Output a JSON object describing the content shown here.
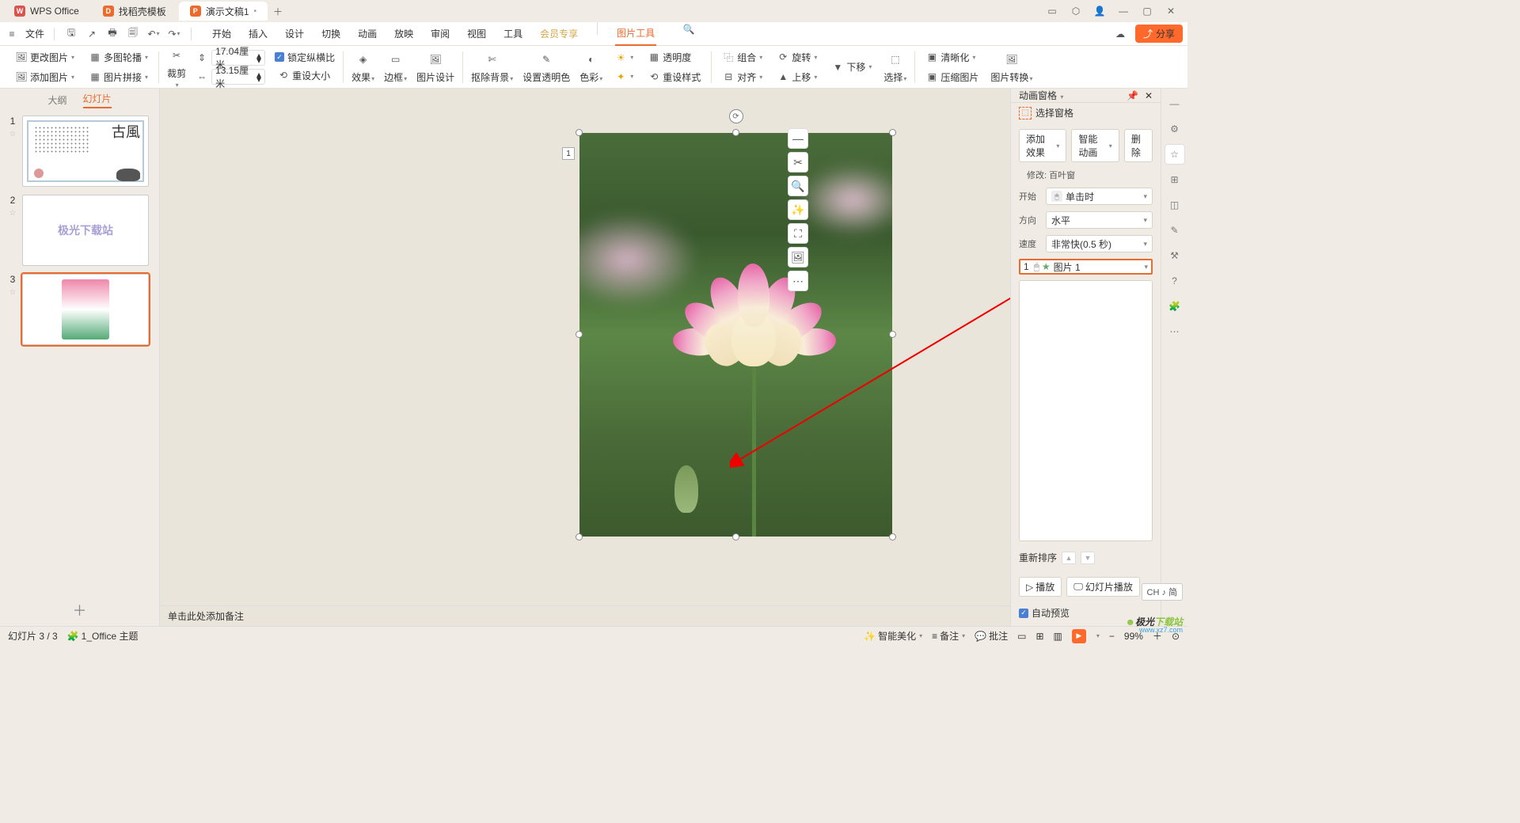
{
  "titlebar": {
    "tabs": [
      {
        "icon_bg": "#d9534f",
        "icon_txt": "W",
        "label": "WPS Office"
      },
      {
        "icon_bg": "#e96b2e",
        "icon_txt": "D",
        "label": "找稻壳模板"
      },
      {
        "icon_bg": "#e96b2e",
        "icon_txt": "P",
        "label": "演示文稿1"
      }
    ]
  },
  "menubar": {
    "file": "文件",
    "tabs": [
      "开始",
      "插入",
      "设计",
      "切换",
      "动画",
      "放映",
      "审阅",
      "视图",
      "工具",
      "会员专享",
      "图片工具"
    ],
    "active": "图片工具",
    "share": "分享"
  },
  "ribbon": {
    "change_pic": "更改图片",
    "multi_rotate": "多图轮播",
    "insert_pic": "添加图片",
    "pic_collage": "图片拼接",
    "crop": "裁剪",
    "height": "17.04厘米",
    "width": "13.15厘米",
    "lock_ratio": "锁定纵横比",
    "reset_size": "重设大小",
    "effects": "效果",
    "border": "边框",
    "pic_design": "图片设计",
    "rm_bg": "抠除背景",
    "set_trans": "设置透明色",
    "color": "色彩",
    "transparency": "透明度",
    "reset_style": "重设样式",
    "combine": "组合",
    "rotate": "旋转",
    "align": "对齐",
    "up": "上移",
    "down": "下移",
    "select": "选择",
    "clarity": "清晰化",
    "compress": "压缩图片",
    "pic_convert": "图片转换"
  },
  "slidepanel": {
    "tab_outline": "大纲",
    "tab_slides": "幻灯片",
    "slides": [
      "1",
      "2",
      "3"
    ],
    "thumb2_text": "极光下载站"
  },
  "canvas": {
    "anim_badge": "1",
    "notes_placeholder": "单击此处添加备注"
  },
  "rightpanel": {
    "title": "动画窗格",
    "select_window": "选择窗格",
    "add_effect": "添加效果",
    "smart_anim": "智能动画",
    "delete": "删除",
    "modify": "修改: 百叶窗",
    "start_label": "开始",
    "start_val": "单击时",
    "dir_label": "方向",
    "dir_val": "水平",
    "speed_label": "速度",
    "speed_val": "非常快(0.5 秒)",
    "item_num": "1",
    "item_name": "图片 1",
    "reorder": "重新排序",
    "play": "播放",
    "slideshow": "幻灯片播放",
    "autopreview": "自动预览"
  },
  "statusbar": {
    "slide_info": "幻灯片 3 / 3",
    "theme": "1_Office 主题",
    "beautify": "智能美化",
    "notes": "备注",
    "comments": "批注",
    "zoom": "99%"
  },
  "ime": "CH ♪ 简",
  "watermark": {
    "line1a": "极光",
    "line1b": "下载站",
    "line2": "www.xz7.com"
  }
}
